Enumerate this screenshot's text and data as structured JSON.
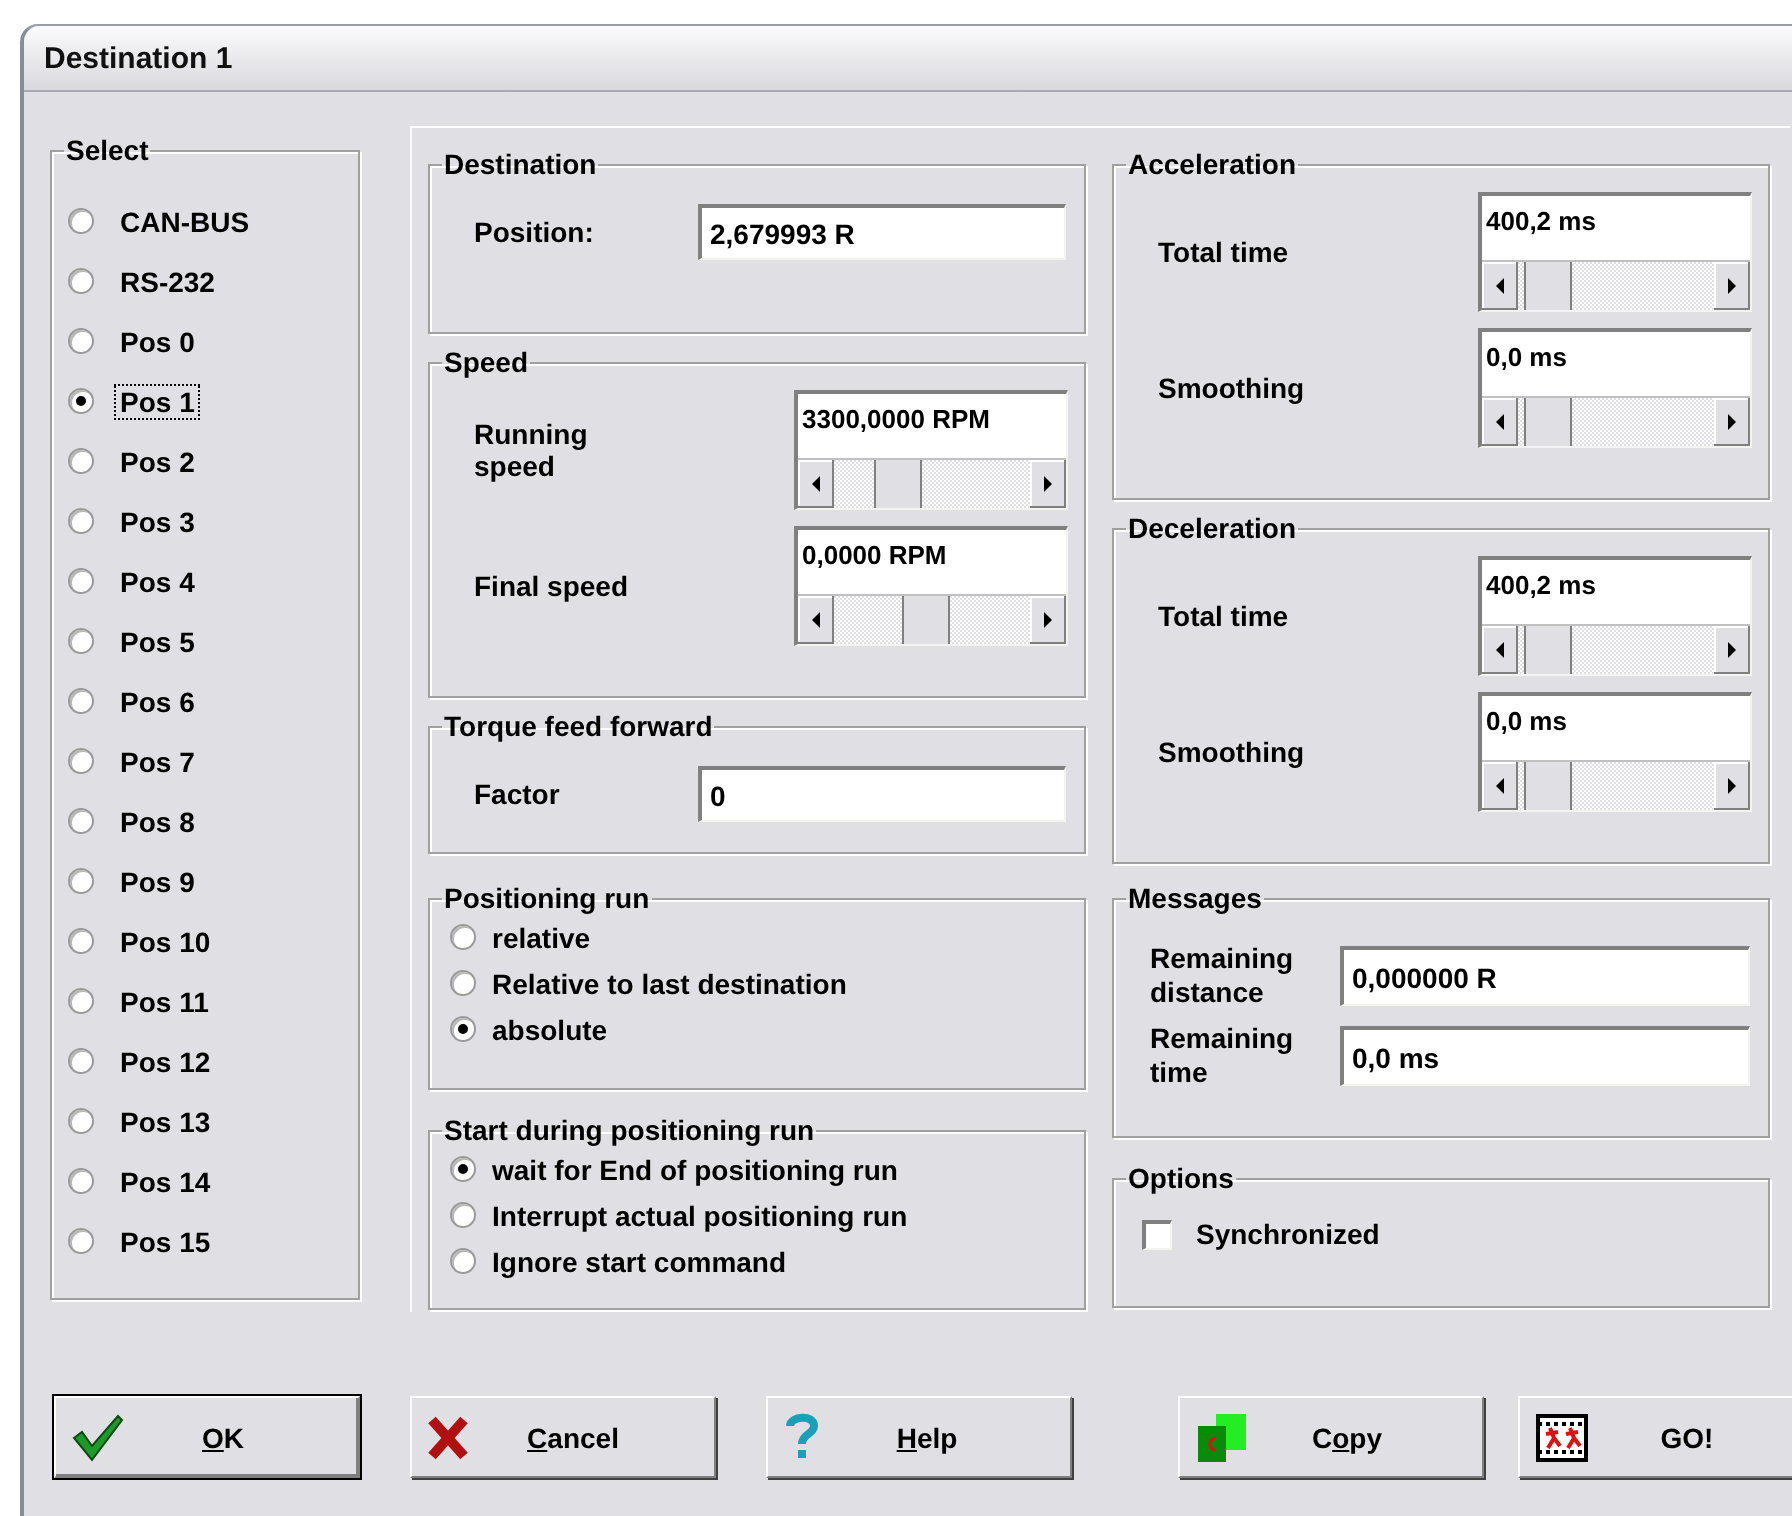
{
  "window": {
    "title": "Destination 1"
  },
  "select": {
    "title": "Select",
    "options": [
      {
        "label": "CAN-BUS",
        "selected": false,
        "focused": false
      },
      {
        "label": "RS-232",
        "selected": false,
        "focused": false
      },
      {
        "label": "Pos 0",
        "selected": false,
        "focused": false
      },
      {
        "label": "Pos 1",
        "selected": true,
        "focused": true
      },
      {
        "label": "Pos 2",
        "selected": false,
        "focused": false
      },
      {
        "label": "Pos 3",
        "selected": false,
        "focused": false
      },
      {
        "label": "Pos 4",
        "selected": false,
        "focused": false
      },
      {
        "label": "Pos 5",
        "selected": false,
        "focused": false
      },
      {
        "label": "Pos 6",
        "selected": false,
        "focused": false
      },
      {
        "label": "Pos 7",
        "selected": false,
        "focused": false
      },
      {
        "label": "Pos 8",
        "selected": false,
        "focused": false
      },
      {
        "label": "Pos 9",
        "selected": false,
        "focused": false
      },
      {
        "label": "Pos 10",
        "selected": false,
        "focused": false
      },
      {
        "label": "Pos 11",
        "selected": false,
        "focused": false
      },
      {
        "label": "Pos 12",
        "selected": false,
        "focused": false
      },
      {
        "label": "Pos 13",
        "selected": false,
        "focused": false
      },
      {
        "label": "Pos 14",
        "selected": false,
        "focused": false
      },
      {
        "label": "Pos 15",
        "selected": false,
        "focused": false
      }
    ]
  },
  "left_groups": [
    {
      "kind": "text",
      "title": "Destination",
      "fields": [
        {
          "label": "Position:",
          "value": "2,679993 R"
        }
      ]
    },
    {
      "kind": "spin",
      "title": "Speed",
      "fields": [
        {
          "label": "Running speed",
          "value": "3300,0000 RPM"
        },
        {
          "label": "Final speed",
          "value": "0,0000 RPM"
        }
      ]
    },
    {
      "kind": "text",
      "title": "Torque feed forward",
      "fields": [
        {
          "label": "Factor",
          "value": "0"
        }
      ]
    },
    {
      "kind": "radios",
      "title": "Positioning run",
      "options": [
        {
          "label": "relative",
          "selected": false
        },
        {
          "label": "Relative to last destination",
          "selected": false
        },
        {
          "label": "absolute",
          "selected": true
        }
      ]
    },
    {
      "kind": "radios",
      "title": "Start during positioning run",
      "options": [
        {
          "label": "wait for End of positioning run",
          "selected": true
        },
        {
          "label": "Interrupt actual positioning run",
          "selected": false
        },
        {
          "label": "Ignore start command",
          "selected": false
        }
      ]
    }
  ],
  "right_groups": [
    {
      "kind": "spin",
      "title": "Acceleration",
      "fields": [
        {
          "label": "Total time",
          "value": "400,2 ms"
        },
        {
          "label": "Smoothing",
          "value": "0,0 ms"
        }
      ]
    },
    {
      "kind": "spin",
      "title": "Deceleration",
      "fields": [
        {
          "label": "Total time",
          "value": "400,2 ms"
        },
        {
          "label": "Smoothing",
          "value": "0,0 ms"
        }
      ]
    },
    {
      "kind": "messages",
      "title": "Messages",
      "fields": [
        {
          "label": "Remaining distance",
          "value": "0,000000 R"
        },
        {
          "label": "Remaining time",
          "value": "0,0 ms"
        }
      ]
    },
    {
      "kind": "checks",
      "title": "Options",
      "options": [
        {
          "label": "Synchronized",
          "checked": false
        }
      ]
    }
  ],
  "buttons": [
    {
      "kind": "ok",
      "key": "O",
      "after": "K"
    },
    {
      "kind": "cancel",
      "key": "C",
      "after": "ancel"
    },
    {
      "kind": "help",
      "key": "H",
      "after": "elp"
    },
    {
      "kind": "copy",
      "before": "C",
      "key": "o",
      "after": "py"
    },
    {
      "kind": "go",
      "before": "GO!"
    }
  ]
}
